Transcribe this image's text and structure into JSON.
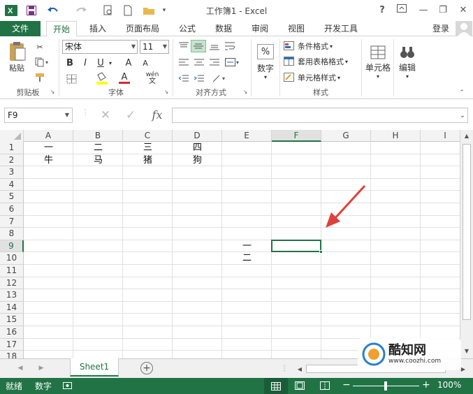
{
  "window": {
    "title": "工作簿1 - Excel",
    "help": "?",
    "minimize": "—",
    "restore": "❐",
    "close": "✕"
  },
  "ribbon_tabs": [
    "文件",
    "开始",
    "插入",
    "页面布局",
    "公式",
    "数据",
    "审阅",
    "视图",
    "开发工具"
  ],
  "account": {
    "login": "登录"
  },
  "clipboard": {
    "paste": "粘贴",
    "group": "剪贴板"
  },
  "font": {
    "name": "宋体",
    "size": "11",
    "bold": "B",
    "italic": "I",
    "underline": "U",
    "grow": "A",
    "shrink": "A",
    "font_color": "A",
    "phonetic": "wén",
    "group": "字体"
  },
  "alignment": {
    "group": "对齐方式"
  },
  "number": {
    "percent": "%",
    "label": "数字"
  },
  "styles": {
    "conditional": "条件格式",
    "table": "套用表格格式",
    "cell": "单元格样式",
    "group": "样式"
  },
  "cells": {
    "label": "单元格"
  },
  "editing": {
    "label": "编辑"
  },
  "formula_bar": {
    "name_box": "F9",
    "fx": "fx",
    "content": ""
  },
  "columns": [
    "A",
    "B",
    "C",
    "D",
    "E",
    "F",
    "G",
    "H",
    "I"
  ],
  "rows": [
    "1",
    "2",
    "3",
    "4",
    "5",
    "6",
    "7",
    "8",
    "9",
    "10",
    "11",
    "12",
    "13",
    "14",
    "15",
    "16",
    "17",
    "18"
  ],
  "selected_cell": "F9",
  "cells_data": {
    "A1": "一",
    "B1": "二",
    "C1": "三",
    "D1": "四",
    "A2": "牛",
    "B2": "马",
    "C2": "猪",
    "D2": "狗",
    "E9": "一",
    "E10": "二"
  },
  "sheets": [
    "Sheet1"
  ],
  "status": {
    "mode": "就绪",
    "num": "数字",
    "zoom": "100%"
  },
  "watermark": {
    "brand": "酷知网",
    "url": "www.coozhi.com"
  },
  "colors": {
    "accent": "#217346",
    "arrow": "#e0403a"
  }
}
